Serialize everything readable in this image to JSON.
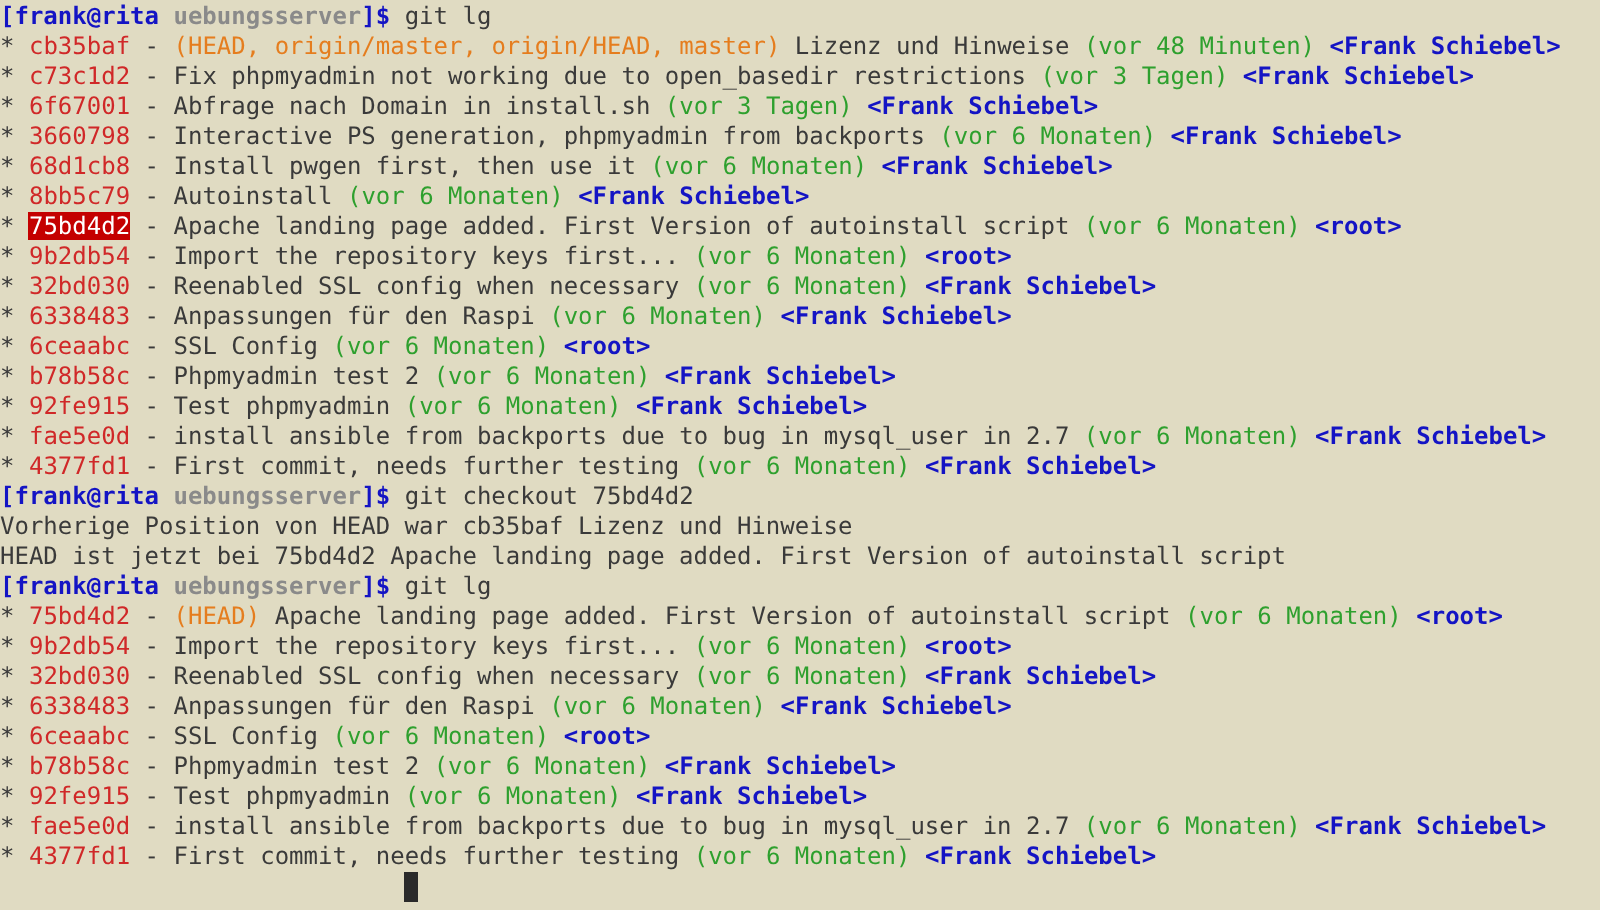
{
  "terminal": {
    "lines": [
      {
        "kind": "prompt",
        "user": "[frank@rita",
        "dir": "uebungsserver",
        "end": "]$",
        "command": "git lg"
      },
      {
        "kind": "commit",
        "graph": "*",
        "hash": "cb35baf",
        "separator": "-",
        "refs": "(HEAD, origin/master, origin/HEAD, master)",
        "message": "Lizenz und Hinweise",
        "date": "(vor 48 Minuten)",
        "author": "<Frank Schiebel>",
        "selected": false
      },
      {
        "kind": "commit",
        "graph": "*",
        "hash": "c73c1d2",
        "separator": "-",
        "message": "Fix phpmyadmin not working due to open_basedir restrictions",
        "date": "(vor 3 Tagen)",
        "author": "<Frank Schiebel>",
        "selected": false
      },
      {
        "kind": "commit",
        "graph": "*",
        "hash": "6f67001",
        "separator": "-",
        "message": "Abfrage nach Domain in install.sh",
        "date": "(vor 3 Tagen)",
        "author": "<Frank Schiebel>",
        "selected": false
      },
      {
        "kind": "commit",
        "graph": "*",
        "hash": "3660798",
        "separator": "-",
        "message": "Interactive PS generation, phpmyadmin from backports",
        "date": "(vor 6 Monaten)",
        "author": "<Frank Schiebel>",
        "selected": false
      },
      {
        "kind": "commit",
        "graph": "*",
        "hash": "68d1cb8",
        "separator": "-",
        "message": "Install pwgen first, then use it",
        "date": "(vor 6 Monaten)",
        "author": "<Frank Schiebel>",
        "selected": false
      },
      {
        "kind": "commit",
        "graph": "*",
        "hash": "8bb5c79",
        "separator": "-",
        "message": "Autoinstall",
        "date": "(vor 6 Monaten)",
        "author": "<Frank Schiebel>",
        "selected": false
      },
      {
        "kind": "commit",
        "graph": "*",
        "hash": "75bd4d2",
        "separator": "-",
        "message": "Apache landing page added. First Version of autoinstall script",
        "date": "(vor 6 Monaten)",
        "author": "<root>",
        "selected": true
      },
      {
        "kind": "commit",
        "graph": "*",
        "hash": "9b2db54",
        "separator": "-",
        "message": "Import the repository keys first...",
        "date": "(vor 6 Monaten)",
        "author": "<root>",
        "selected": false
      },
      {
        "kind": "commit",
        "graph": "*",
        "hash": "32bd030",
        "separator": "-",
        "message": "Reenabled SSL config when necessary",
        "date": "(vor 6 Monaten)",
        "author": "<Frank Schiebel>",
        "selected": false
      },
      {
        "kind": "commit",
        "graph": "*",
        "hash": "6338483",
        "separator": "-",
        "message": "Anpassungen für den Raspi",
        "date": "(vor 6 Monaten)",
        "author": "<Frank Schiebel>",
        "selected": false
      },
      {
        "kind": "commit",
        "graph": "*",
        "hash": "6ceaabc",
        "separator": "-",
        "message": "SSL Config",
        "date": "(vor 6 Monaten)",
        "author": "<root>",
        "selected": false
      },
      {
        "kind": "commit",
        "graph": "*",
        "hash": "b78b58c",
        "separator": "-",
        "message": "Phpmyadmin test 2",
        "date": "(vor 6 Monaten)",
        "author": "<Frank Schiebel>",
        "selected": false
      },
      {
        "kind": "commit",
        "graph": "*",
        "hash": "92fe915",
        "separator": "-",
        "message": "Test phpmyadmin",
        "date": "(vor 6 Monaten)",
        "author": "<Frank Schiebel>",
        "selected": false
      },
      {
        "kind": "commit",
        "graph": "*",
        "hash": "fae5e0d",
        "separator": "-",
        "message": "install ansible from backports due to bug in mysql_user in 2.7",
        "date": "(vor 6 Monaten)",
        "author": "<Frank Schiebel>",
        "selected": false
      },
      {
        "kind": "commit",
        "graph": "*",
        "hash": "4377fd1",
        "separator": "-",
        "message": "First commit, needs further testing",
        "date": "(vor 6 Monaten)",
        "author": "<Frank Schiebel>",
        "selected": false
      },
      {
        "kind": "prompt",
        "user": "[frank@rita",
        "dir": "uebungsserver",
        "end": "]$",
        "command": "git checkout 75bd4d2"
      },
      {
        "kind": "output",
        "text": "Vorherige Position von HEAD war cb35baf Lizenz und Hinweise"
      },
      {
        "kind": "output",
        "text": "HEAD ist jetzt bei 75bd4d2 Apache landing page added. First Version of autoinstall script"
      },
      {
        "kind": "prompt",
        "user": "[frank@rita",
        "dir": "uebungsserver",
        "end": "]$",
        "command": "git lg"
      },
      {
        "kind": "commit",
        "graph": "*",
        "hash": "75bd4d2",
        "separator": "-",
        "refs": "(HEAD)",
        "message": "Apache landing page added. First Version of autoinstall script",
        "date": "(vor 6 Monaten)",
        "author": "<root>",
        "selected": false
      },
      {
        "kind": "commit",
        "graph": "*",
        "hash": "9b2db54",
        "separator": "-",
        "message": "Import the repository keys first...",
        "date": "(vor 6 Monaten)",
        "author": "<root>",
        "selected": false
      },
      {
        "kind": "commit",
        "graph": "*",
        "hash": "32bd030",
        "separator": "-",
        "message": "Reenabled SSL config when necessary",
        "date": "(vor 6 Monaten)",
        "author": "<Frank Schiebel>",
        "selected": false
      },
      {
        "kind": "commit",
        "graph": "*",
        "hash": "6338483",
        "separator": "-",
        "message": "Anpassungen für den Raspi",
        "date": "(vor 6 Monaten)",
        "author": "<Frank Schiebel>",
        "selected": false
      },
      {
        "kind": "commit",
        "graph": "*",
        "hash": "6ceaabc",
        "separator": "-",
        "message": "SSL Config",
        "date": "(vor 6 Monaten)",
        "author": "<root>",
        "selected": false
      },
      {
        "kind": "commit",
        "graph": "*",
        "hash": "b78b58c",
        "separator": "-",
        "message": "Phpmyadmin test 2",
        "date": "(vor 6 Monaten)",
        "author": "<Frank Schiebel>",
        "selected": false
      },
      {
        "kind": "commit",
        "graph": "*",
        "hash": "92fe915",
        "separator": "-",
        "message": "Test phpmyadmin",
        "date": "(vor 6 Monaten)",
        "author": "<Frank Schiebel>",
        "selected": false
      },
      {
        "kind": "commit",
        "graph": "*",
        "hash": "fae5e0d",
        "separator": "-",
        "message": "install ansible from backports due to bug in mysql_user in 2.7",
        "date": "(vor 6 Monaten)",
        "author": "<Frank Schiebel>",
        "selected": false
      },
      {
        "kind": "commit",
        "graph": "*",
        "hash": "4377fd1",
        "separator": "-",
        "message": "First commit, needs further testing",
        "date": "(vor 6 Monaten)",
        "author": "<Frank Schiebel>",
        "selected": false
      },
      {
        "kind": "cursor"
      }
    ]
  }
}
